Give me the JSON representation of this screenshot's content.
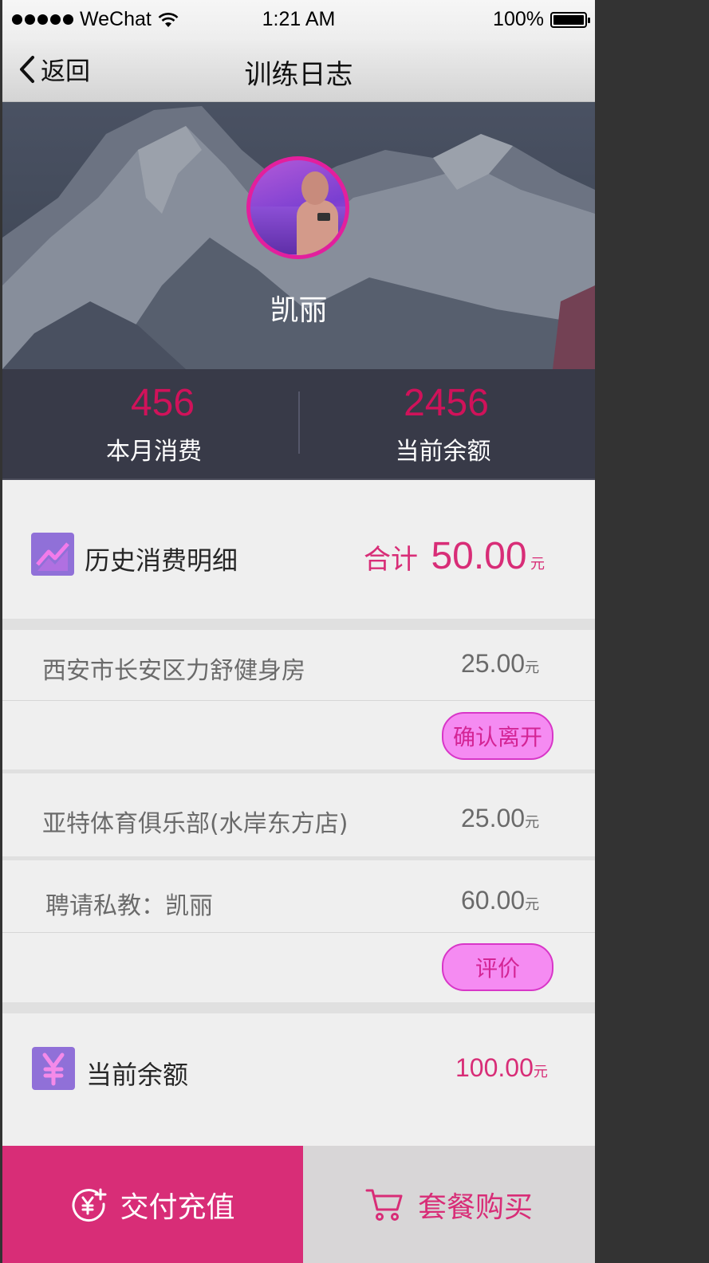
{
  "status_bar": {
    "carrier": "WeChat",
    "time": "1:21 AM",
    "battery": "100%"
  },
  "nav": {
    "back_label": "返回",
    "title": "训练日志"
  },
  "profile": {
    "name": "凯丽"
  },
  "stats": {
    "month_spend_value": "456",
    "month_spend_label": "本月消费",
    "balance_value": "2456",
    "balance_label": "当前余额"
  },
  "history": {
    "title": "历史消费明细",
    "total_label": "合计",
    "total_value": "50.00",
    "currency": "元"
  },
  "records": [
    {
      "name": "西安市长安区力舒健身房",
      "amount": "25.00",
      "currency": "元",
      "action": "确认离开"
    },
    {
      "name": "亚特体育俱乐部(水岸东方店)",
      "amount": "25.00",
      "currency": "元"
    },
    {
      "name": "聘请私教：凯丽",
      "amount": "60.00",
      "currency": "元",
      "action": "评价"
    }
  ],
  "balance_row": {
    "title": "当前余额",
    "value": "100.00",
    "currency": "元"
  },
  "bottom_bar": {
    "pay_label": "交付充值",
    "buy_label": "套餐购买"
  },
  "colors": {
    "accent": "#d82d77",
    "stat_number": "#d0125a",
    "stats_bg": "#383a48",
    "icon_bg": "#9070d8",
    "button_bg": "#f58bf2"
  },
  "icons": {
    "back": "chevron-left-icon",
    "history": "trend-chart-icon",
    "balance": "yen-icon",
    "pay": "yen-plus-icon",
    "buy": "cart-icon",
    "wifi": "wifi-icon",
    "battery": "battery-icon"
  }
}
